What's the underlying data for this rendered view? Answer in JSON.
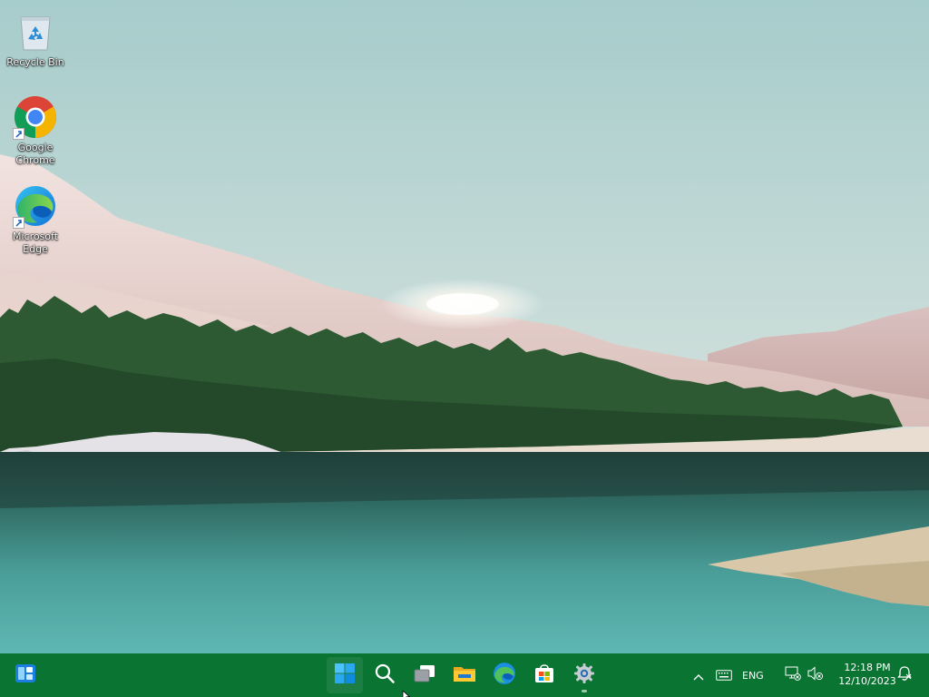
{
  "desktop": {
    "icons": [
      {
        "label": "Recycle Bin"
      },
      {
        "label": "Google Chrome"
      },
      {
        "label": "Microsoft Edge"
      }
    ]
  },
  "taskbar": {
    "widgets_icon": "widgets-icon",
    "pinned": [
      {
        "icon": "windows-start-icon"
      },
      {
        "icon": "search-icon"
      },
      {
        "icon": "task-view-icon"
      },
      {
        "icon": "file-explorer-icon"
      },
      {
        "icon": "edge-icon"
      },
      {
        "icon": "microsoft-store-icon"
      },
      {
        "icon": "settings-gear-icon"
      }
    ],
    "tray": {
      "language": "ENG",
      "time": "12:18 PM",
      "date": "12/10/2023"
    }
  },
  "colors": {
    "taskbar": "#0a7433",
    "sky": "#a9cdcc",
    "water": "#3f8f8c"
  }
}
